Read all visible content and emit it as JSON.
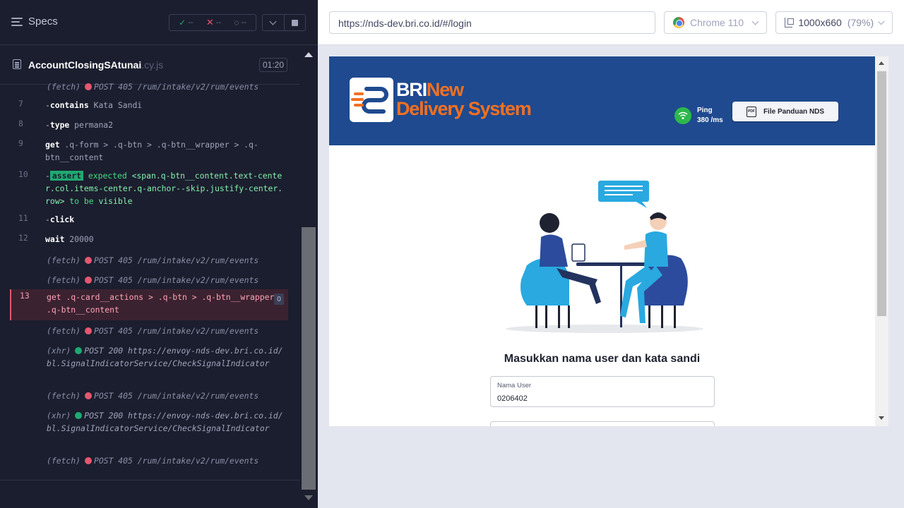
{
  "reporter": {
    "specs_label": "Specs",
    "stats": {
      "passed": "--",
      "failed": "--",
      "pending": "--"
    },
    "file": {
      "name": "AccountClosingSAtunai",
      "ext": ".cy.js",
      "duration": "01:20"
    },
    "commands": [
      {
        "num": "",
        "kind": "fetch",
        "prefix": "(fetch)",
        "status": "red",
        "text": "POST 405 /rum/intake/v2/rum/events"
      },
      {
        "num": "7",
        "kind": "cmd",
        "dash": "-",
        "name": "contains",
        "arg": "Kata Sandi"
      },
      {
        "num": "8",
        "kind": "cmd",
        "dash": "-",
        "name": "type",
        "arg": "permana2"
      },
      {
        "num": "9",
        "kind": "cmd",
        "dash": "",
        "name": "get",
        "arg": ".q-form > .q-btn > .q-btn__wrapper > .q-btn__content"
      },
      {
        "num": "10",
        "kind": "assert",
        "dash": "-",
        "badge": "assert",
        "expected": "expected",
        "subject": "<span.q-btn__content.text-center.col.items-center.q-anchor--skip.justify-center.row>",
        "tobe": "to be",
        "state": "visible"
      },
      {
        "num": "11",
        "kind": "cmd",
        "dash": "-",
        "name": "click",
        "arg": ""
      },
      {
        "num": "12",
        "kind": "cmd",
        "dash": "",
        "name": "wait",
        "arg": "20000"
      },
      {
        "num": "",
        "kind": "fetch",
        "prefix": "(fetch)",
        "status": "red",
        "text": "POST 405 /rum/intake/v2/rum/events"
      },
      {
        "num": "",
        "kind": "fetch",
        "prefix": "(fetch)",
        "status": "red",
        "text": "POST 405 /rum/intake/v2/rum/events"
      },
      {
        "num": "13",
        "kind": "active",
        "dash": "",
        "name": "get",
        "arg": ".q-card__actions > .q-btn > .q-btn__wrapper > .q-btn__content",
        "count": "0"
      },
      {
        "num": "",
        "kind": "fetch",
        "prefix": "(fetch)",
        "status": "red",
        "text": "POST 405 /rum/intake/v2/rum/events"
      },
      {
        "num": "",
        "kind": "xhr",
        "prefix": "(xhr)",
        "status": "green",
        "text": "POST 200 https://envoy-nds-dev.bri.co.id/bl.SignalIndicatorService/CheckSignalIndicator"
      },
      {
        "num": "",
        "kind": "fetch",
        "prefix": "(fetch)",
        "status": "red",
        "text": "POST 405 /rum/intake/v2/rum/events"
      },
      {
        "num": "",
        "kind": "xhr",
        "prefix": "(xhr)",
        "status": "green",
        "text": "POST 200 https://envoy-nds-dev.bri.co.id/bl.SignalIndicatorService/CheckSignalIndicator"
      },
      {
        "num": "",
        "kind": "fetch",
        "prefix": "(fetch)",
        "status": "red",
        "text": "POST 405 /rum/intake/v2/rum/events"
      }
    ]
  },
  "browser": {
    "url": "https://nds-dev.bri.co.id/#/login",
    "browser_name": "Chrome 110",
    "viewport": "1000x660",
    "zoom": "(79%)"
  },
  "app": {
    "logo_line1_a": "BRI",
    "logo_line1_b": "New",
    "logo_line2": "Delivery System",
    "ping_label": "Ping",
    "ping_value": "380 /ms",
    "manual_button": "File Panduan NDS",
    "pdf_icon_text": "PDF",
    "login_title": "Masukkan nama user dan kata sandi",
    "username_label": "Nama User",
    "username_value": "0206402"
  },
  "colors": {
    "header_blue": "#1f4a8f",
    "brand_orange": "#f37021",
    "pass_green": "#1fa971",
    "fail_red": "#e45770"
  }
}
